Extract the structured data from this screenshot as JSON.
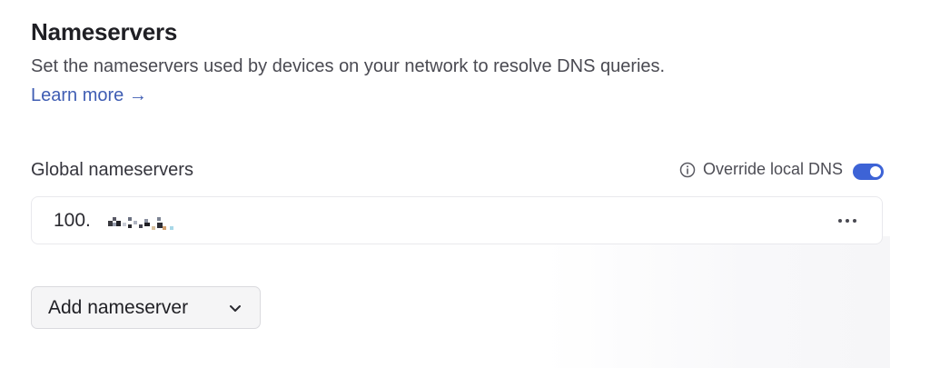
{
  "section": {
    "title": "Nameservers",
    "description": "Set the nameservers used by devices on your network to resolve DNS queries.",
    "learn_more": "Learn more →"
  },
  "global": {
    "label": "Global nameservers",
    "override_label": "Override local DNS",
    "override_enabled": true,
    "info_icon": "info-icon",
    "toggle_color": "#3d63d6"
  },
  "nameservers": [
    {
      "value": "100.",
      "redacted": true,
      "menu_icon": "more-horizontal-icon"
    }
  ],
  "add_button": {
    "label": "Add nameserver",
    "icon": "chevron-down-icon"
  },
  "colors": {
    "link": "#3f5db3",
    "accent": "#3d63d6"
  }
}
